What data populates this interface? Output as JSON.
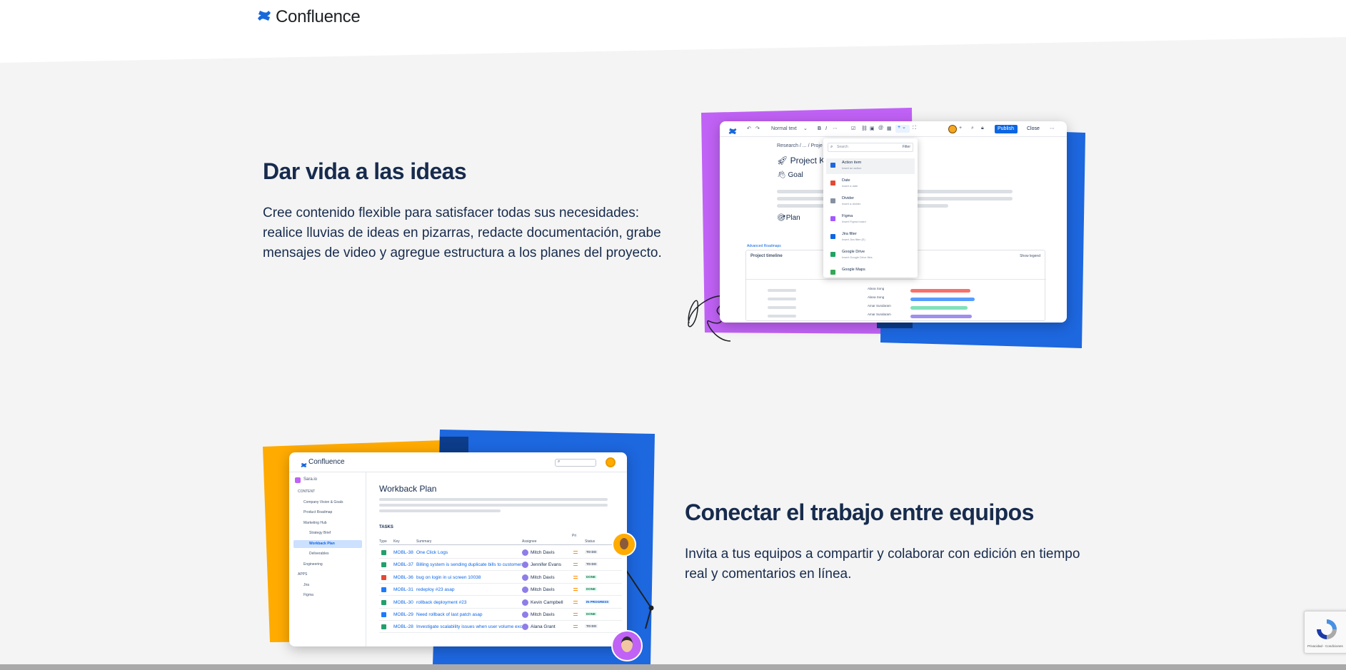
{
  "header": {
    "logo_text": "Confluence",
    "logo_icon": "confluence-logo-icon"
  },
  "section1": {
    "title": "Dar vida a las ideas",
    "description": "Cree contenido flexible para satisfacer todas sus necesidades: realice lluvias de ideas en pizarras, redacte documentación, grabe mensajes de video y agregue estructura a los planes del proyecto.",
    "mockup": {
      "toolbar_text_style": "Normal text",
      "publish_label": "Publish",
      "close_label": "Close",
      "breadcrumb": "Research / ... / Proje",
      "page_title": "Project K",
      "goal_label": "Goal",
      "plan_label": "Plan",
      "search_placeholder": "Search",
      "filter_label": "Filter",
      "menu_items": [
        {
          "label": "Action item",
          "sub": "Insert an action"
        },
        {
          "label": "Date",
          "sub": "Insert a date"
        },
        {
          "label": "Divider",
          "sub": "Insert a divider"
        },
        {
          "label": "Figma",
          "sub": "Insert Figma board"
        },
        {
          "label": "Jira filter",
          "sub": "Insert Jira filter (E)"
        },
        {
          "label": "Google Drive",
          "sub": "Insert Google Drive files"
        },
        {
          "label": "Google Maps",
          "sub": ""
        }
      ],
      "roadmap_tag": "Advanced Roadmaps",
      "timeline_title": "Project timeline",
      "show_legend": "Show legend",
      "people": [
        "Alana Song",
        "Alana Song",
        "Amar Sundaram",
        "Amar Sundaram"
      ]
    },
    "colors": {
      "purple": "#c062f5",
      "blue": "#1d67df"
    }
  },
  "section2": {
    "title": "Conectar el trabajo entre equipos",
    "description": "Invita a tus equipos a compartir y colaborar con edición en tiempo real y comentarios en línea.",
    "mockup": {
      "app_name": "Confluence",
      "space_name": "Sara.io",
      "sidebar": [
        "CONTENT",
        "Company Vision & Goals",
        "Product Roadmap",
        "Marketing Hub",
        "Strategy Brief",
        "Workback Plan",
        "Deliverables",
        "Engineering",
        "APPS",
        "Jira",
        "Figma"
      ],
      "page_title": "Workback Plan",
      "tasks_heading": "TASKS",
      "columns": [
        "Type",
        "Key",
        "Summary",
        "Assignee",
        "Pri",
        "Status"
      ],
      "rows": [
        {
          "key": "MOBL-38",
          "summary": "One Click Logs",
          "assignee": "Mitch Davis",
          "status": "TO DO"
        },
        {
          "key": "MOBL-37",
          "summary": "Billing system is sending duplicate bills to customers",
          "assignee": "Jennifer Evans",
          "status": "TO DO"
        },
        {
          "key": "MOBL-36",
          "summary": "bug on login in ui screen 10038",
          "assignee": "Mitch Davis",
          "status": "DONE"
        },
        {
          "key": "MOBL-31",
          "summary": "redeploy #23 asap",
          "assignee": "Mitch Davis",
          "status": "DONE"
        },
        {
          "key": "MOBL-30",
          "summary": "rollback deployment #23",
          "assignee": "Kevin Campbell",
          "status": "IN PROGRESS"
        },
        {
          "key": "MOBL-29",
          "summary": "Need rollback of last patch asap",
          "assignee": "Mitch Davis",
          "status": "DONE"
        },
        {
          "key": "MOBL-28",
          "summary": "Investigate scalability issues when user volume exce...",
          "assignee": "Alana Grant",
          "status": "TO DO"
        }
      ]
    },
    "colors": {
      "yellow": "#ffab00",
      "blue": "#1d67df"
    }
  },
  "recaptcha": {
    "text": "Privacidad - Condiciones"
  }
}
